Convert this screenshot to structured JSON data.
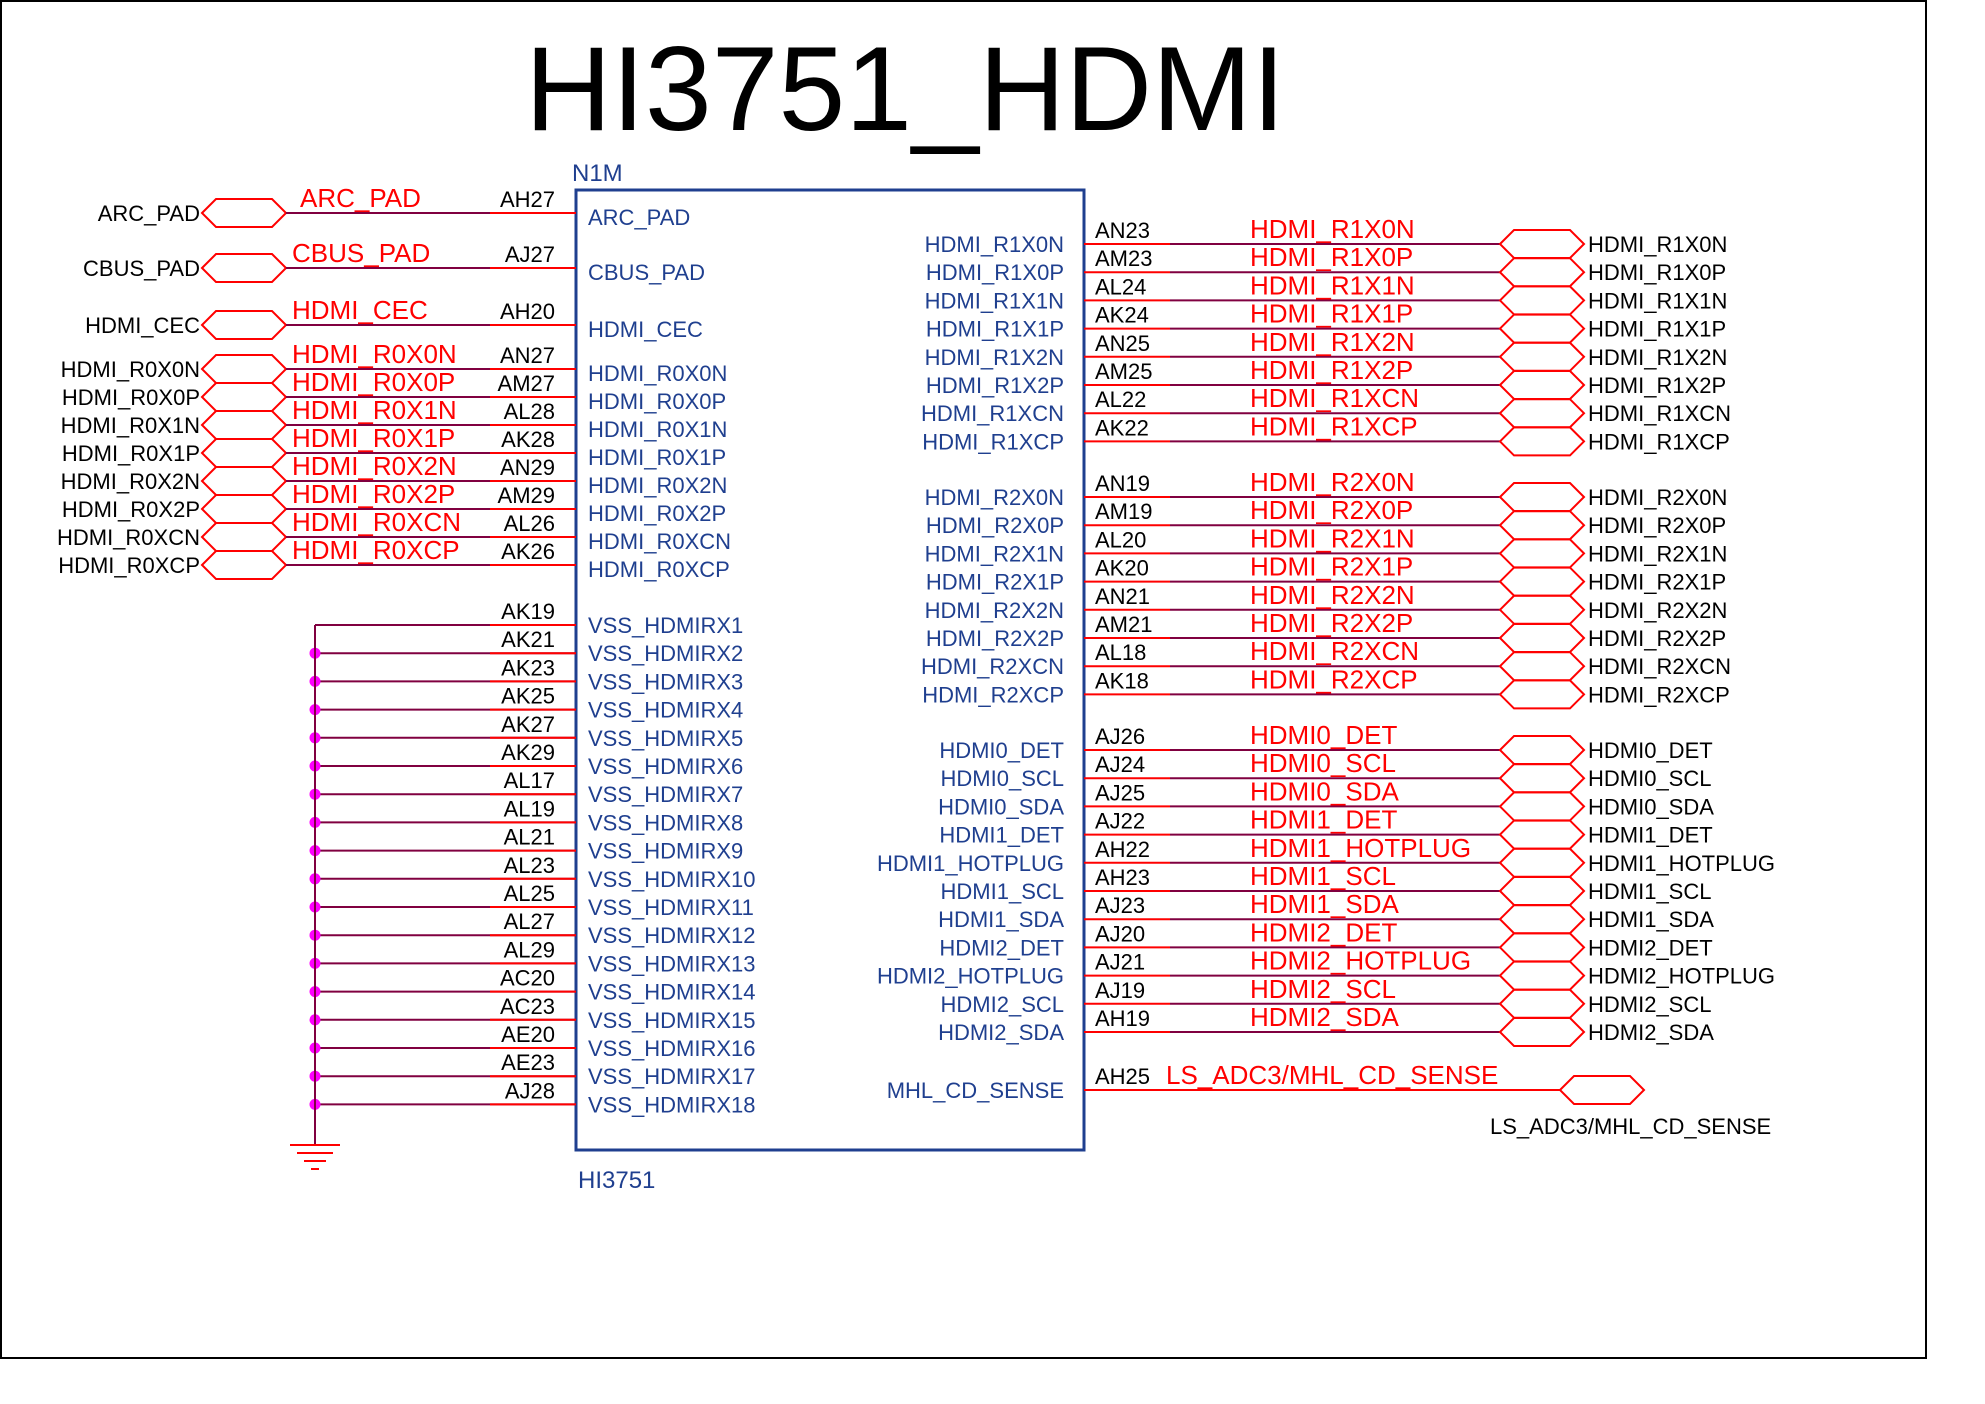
{
  "title": "HI3751_HDMI",
  "part": {
    "ref": "N1M",
    "name": "HI3751"
  },
  "colors": {
    "pin_text": "#1f3f8f",
    "net_red": "#ff0000",
    "wire": "#800040",
    "junction": "#ff00ff",
    "port_text": "#000000",
    "body": "#1f3f8f"
  },
  "left_signals": [
    {
      "pin": "ARC_PAD",
      "ball": "AH27",
      "net": "ARC_PAD",
      "port": "ARC_PAD"
    },
    {
      "pin": "CBUS_PAD",
      "ball": "AJ27",
      "net": "CBUS_PAD",
      "port": "CBUS_PAD"
    },
    {
      "pin": "HDMI_CEC",
      "ball": "AH20",
      "net": "HDMI_CEC",
      "port": "HDMI_CEC"
    },
    {
      "pin": "HDMI_R0X0N",
      "ball": "AN27",
      "net": "HDMI_R0X0N",
      "port": "HDMI_R0X0N"
    },
    {
      "pin": "HDMI_R0X0P",
      "ball": "AM27",
      "net": "HDMI_R0X0P",
      "port": "HDMI_R0X0P"
    },
    {
      "pin": "HDMI_R0X1N",
      "ball": "AL28",
      "net": "HDMI_R0X1N",
      "port": "HDMI_R0X1N"
    },
    {
      "pin": "HDMI_R0X1P",
      "ball": "AK28",
      "net": "HDMI_R0X1P",
      "port": "HDMI_R0X1P"
    },
    {
      "pin": "HDMI_R0X2N",
      "ball": "AN29",
      "net": "HDMI_R0X2N",
      "port": "HDMI_R0X2N"
    },
    {
      "pin": "HDMI_R0X2P",
      "ball": "AM29",
      "net": "HDMI_R0X2P",
      "port": "HDMI_R0X2P"
    },
    {
      "pin": "HDMI_R0XCN",
      "ball": "AL26",
      "net": "HDMI_R0XCN",
      "port": "HDMI_R0XCN"
    },
    {
      "pin": "HDMI_R0XCP",
      "ball": "AK26",
      "net": "HDMI_R0XCP",
      "port": "HDMI_R0XCP"
    }
  ],
  "vss_pins": [
    {
      "pin": "VSS_HDMIRX1",
      "ball": "AK19"
    },
    {
      "pin": "VSS_HDMIRX2",
      "ball": "AK21"
    },
    {
      "pin": "VSS_HDMIRX3",
      "ball": "AK23"
    },
    {
      "pin": "VSS_HDMIRX4",
      "ball": "AK25"
    },
    {
      "pin": "VSS_HDMIRX5",
      "ball": "AK27"
    },
    {
      "pin": "VSS_HDMIRX6",
      "ball": "AK29"
    },
    {
      "pin": "VSS_HDMIRX7",
      "ball": "AL17"
    },
    {
      "pin": "VSS_HDMIRX8",
      "ball": "AL19"
    },
    {
      "pin": "VSS_HDMIRX9",
      "ball": "AL21"
    },
    {
      "pin": "VSS_HDMIRX10",
      "ball": "AL23"
    },
    {
      "pin": "VSS_HDMIRX11",
      "ball": "AL25"
    },
    {
      "pin": "VSS_HDMIRX12",
      "ball": "AL27"
    },
    {
      "pin": "VSS_HDMIRX13",
      "ball": "AL29"
    },
    {
      "pin": "VSS_HDMIRX14",
      "ball": "AC20"
    },
    {
      "pin": "VSS_HDMIRX15",
      "ball": "AC23"
    },
    {
      "pin": "VSS_HDMIRX16",
      "ball": "AE20"
    },
    {
      "pin": "VSS_HDMIRX17",
      "ball": "AE23"
    },
    {
      "pin": "VSS_HDMIRX18",
      "ball": "AJ28"
    }
  ],
  "right_signals": [
    {
      "pin": "HDMI_R1X0N",
      "ball": "AN23",
      "net": "HDMI_R1X0N",
      "port": "HDMI_R1X0N"
    },
    {
      "pin": "HDMI_R1X0P",
      "ball": "AM23",
      "net": "HDMI_R1X0P",
      "port": "HDMI_R1X0P"
    },
    {
      "pin": "HDMI_R1X1N",
      "ball": "AL24",
      "net": "HDMI_R1X1N",
      "port": "HDMI_R1X1N"
    },
    {
      "pin": "HDMI_R1X1P",
      "ball": "AK24",
      "net": "HDMI_R1X1P",
      "port": "HDMI_R1X1P"
    },
    {
      "pin": "HDMI_R1X2N",
      "ball": "AN25",
      "net": "HDMI_R1X2N",
      "port": "HDMI_R1X2N"
    },
    {
      "pin": "HDMI_R1X2P",
      "ball": "AM25",
      "net": "HDMI_R1X2P",
      "port": "HDMI_R1X2P"
    },
    {
      "pin": "HDMI_R1XCN",
      "ball": "AL22",
      "net": "HDMI_R1XCN",
      "port": "HDMI_R1XCN"
    },
    {
      "pin": "HDMI_R1XCP",
      "ball": "AK22",
      "net": "HDMI_R1XCP",
      "port": "HDMI_R1XCP"
    },
    {
      "pin": "HDMI_R2X0N",
      "ball": "AN19",
      "net": "HDMI_R2X0N",
      "port": "HDMI_R2X0N"
    },
    {
      "pin": "HDMI_R2X0P",
      "ball": "AM19",
      "net": "HDMI_R2X0P",
      "port": "HDMI_R2X0P"
    },
    {
      "pin": "HDMI_R2X1N",
      "ball": "AL20",
      "net": "HDMI_R2X1N",
      "port": "HDMI_R2X1N"
    },
    {
      "pin": "HDMI_R2X1P",
      "ball": "AK20",
      "net": "HDMI_R2X1P",
      "port": "HDMI_R2X1P"
    },
    {
      "pin": "HDMI_R2X2N",
      "ball": "AN21",
      "net": "HDMI_R2X2N",
      "port": "HDMI_R2X2N"
    },
    {
      "pin": "HDMI_R2X2P",
      "ball": "AM21",
      "net": "HDMI_R2X2P",
      "port": "HDMI_R2X2P"
    },
    {
      "pin": "HDMI_R2XCN",
      "ball": "AL18",
      "net": "HDMI_R2XCN",
      "port": "HDMI_R2XCN"
    },
    {
      "pin": "HDMI_R2XCP",
      "ball": "AK18",
      "net": "HDMI_R2XCP",
      "port": "HDMI_R2XCP"
    },
    {
      "pin": "HDMI0_DET",
      "ball": "AJ26",
      "net": "HDMI0_DET",
      "port": "HDMI0_DET"
    },
    {
      "pin": "HDMI0_SCL",
      "ball": "AJ24",
      "net": "HDMI0_SCL",
      "port": "HDMI0_SCL"
    },
    {
      "pin": "HDMI0_SDA",
      "ball": "AJ25",
      "net": "HDMI0_SDA",
      "port": "HDMI0_SDA"
    },
    {
      "pin": "HDMI1_DET",
      "ball": "AJ22",
      "net": "HDMI1_DET",
      "port": "HDMI1_DET"
    },
    {
      "pin": "HDMI1_HOTPLUG",
      "ball": "AH22",
      "net": "HDMI1_HOTPLUG",
      "port": "HDMI1_HOTPLUG"
    },
    {
      "pin": "HDMI1_SCL",
      "ball": "AH23",
      "net": "HDMI1_SCL",
      "port": "HDMI1_SCL"
    },
    {
      "pin": "HDMI1_SDA",
      "ball": "AJ23",
      "net": "HDMI1_SDA",
      "port": "HDMI1_SDA"
    },
    {
      "pin": "HDMI2_DET",
      "ball": "AJ20",
      "net": "HDMI2_DET",
      "port": "HDMI2_DET"
    },
    {
      "pin": "HDMI2_HOTPLUG",
      "ball": "AJ21",
      "net": "HDMI2_HOTPLUG",
      "port": "HDMI2_HOTPLUG"
    },
    {
      "pin": "HDMI2_SCL",
      "ball": "AJ19",
      "net": "HDMI2_SCL",
      "port": "HDMI2_SCL"
    },
    {
      "pin": "HDMI2_SDA",
      "ball": "AH19",
      "net": "HDMI2_SDA",
      "port": "HDMI2_SDA"
    },
    {
      "pin": "MHL_CD_SENSE",
      "ball": "AH25",
      "net": "LS_ADC3/MHL_CD_SENSE",
      "port": "LS_ADC3/MHL_CD_SENSE"
    }
  ]
}
